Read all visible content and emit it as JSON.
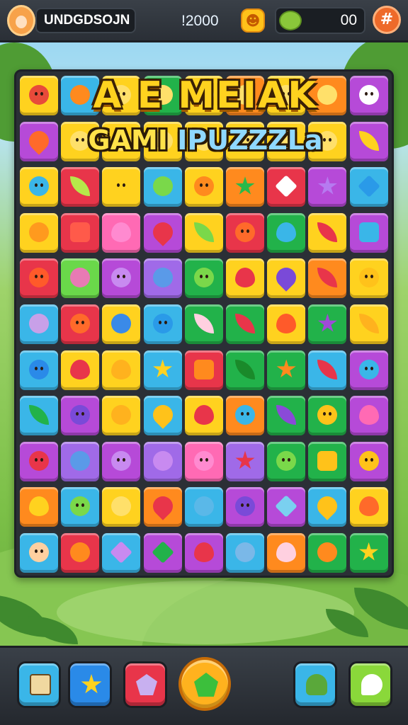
{
  "header": {
    "player_name": "UNDGDSOJN",
    "score": "!2000",
    "gem_count": "00",
    "icons": [
      "avatar",
      "coin-icon",
      "gem-icon",
      "menu-icon"
    ]
  },
  "title": {
    "line1": "A E MEIAK",
    "line2_part1": "GAMI ",
    "line2_part2": "IPUZZZLa"
  },
  "board": {
    "rows": 12,
    "cols": 9,
    "tiles": [
      [
        "#ffd21f:circle:#e84a3a",
        "#3ab6e8:circle:#ff8a1e",
        "#ffd21f:circle:#ffe06a",
        "#22b24a:circle:#ffe06a",
        "#ffd21f:circle:#ffe06a",
        "#ff8a1e:circle:#ffe06a",
        "#ffd21f:circle:#ffe06a",
        "#ff8a1e:circle:#ffe06a",
        "#b64ad8:circle:#ffffff"
      ],
      [
        "#b64ad8:drop:#ff6a2a",
        "#ffd21f:circle:#ffe06a",
        "#ffd21f:circle:#ffe06a",
        "#ffd21f:circle:#ffe06a",
        "#ffd21f:circle:#ffe06a",
        "#ffd21f:circle:#ffe06a",
        "#ffd21f:circle:#ffe06a",
        "#ffd21f:circle:#ffe06a",
        "#b64ad8:leaf:#ffd21f"
      ],
      [
        "#ffd21f:circle:#3ab6e8",
        "#e8354a:leaf:#b6e84a",
        "#ffd21f:circle:#ffd21f",
        "#3ab6e8:circle:#7ad84a",
        "#ffd21f:circle:#ff8a1e",
        "#ff8a1e:star:#2ab84a",
        "#e8354a:diamond:#ffffff",
        "#b64ad8:star:#b67af0",
        "#3ab6e8:diamond:#2a9ae8"
      ],
      [
        "#ffd21f:circle:#ff9a1e",
        "#e8354a:square:#ff5a4a",
        "#ff6ab4:heart:#ff8ad0",
        "#b64ad8:drop:#e8354a",
        "#ffd21f:leaf:#7ad84a",
        "#e8354a:circle:#ff6a2a",
        "#22b24a:heart:#3ab6e8",
        "#ffd21f:leaf:#e8354a",
        "#b64ad8:square:#3ab6e8"
      ],
      [
        "#e8354a:circle:#ff5a2a",
        "#6ad84a:circle:#e87ab4",
        "#b64ad8:circle:#c88af0",
        "#a06ae8:circle:#5a9ae8",
        "#22b24a:circle:#7ad84a",
        "#ffd21f:heart:#e8354a",
        "#ffd21f:drop:#7a4ad8",
        "#ff8a1e:leaf:#e8354a",
        "#ffd21f:circle:#ffc21a"
      ],
      [
        "#3ab6e8:circle:#c8a0e8",
        "#e8354a:circle:#ff6a2a",
        "#ffd21f:circle:#3a8ae8",
        "#3ab6e8:circle:#2a9ae8",
        "#22b24a:leaf:#ffd0e0",
        "#22b24a:leaf:#e8354a",
        "#ffd21f:heart:#ff5a2a",
        "#22b24a:star:#a04ad8",
        "#ffd21f:leaf:#ffb21e"
      ],
      [
        "#3ab6e8:circle:#2a8ae8",
        "#ffd21f:heart:#e8354a",
        "#ffd21f:heart:#ffb21e",
        "#3ab6e8:star:#ffd21f",
        "#e8354a:square:#ff8a1e",
        "#22b24a:leaf:#1a8a2a",
        "#22b24a:star:#ff8a1e",
        "#3ab6e8:leaf:#e8354a",
        "#b64ad8:circle:#3ab6e8"
      ],
      [
        "#3ab6e8:leaf:#22b24a",
        "#b64ad8:circle:#7a4ad8",
        "#ffd21f:circle:#ffb21e",
        "#3ab6e8:drop:#ffc21a",
        "#ffd21f:heart:#e8354a",
        "#ff8a1e:circle:#3ab6e8",
        "#22b24a:leaf:#8a4ad8",
        "#22b24a:circle:#ffc21a",
        "#b64ad8:heart:#ff6ab4"
      ],
      [
        "#b64ad8:circle:#e8354a",
        "#a06ae8:circle:#5a9ae8",
        "#b64ad8:circle:#c88af0",
        "#a06ae8:circle:#c88af0",
        "#ff6ab4:circle:#ff8ad0",
        "#a06ae8:star:#e8354a",
        "#22b24a:circle:#7ad84a",
        "#22b24a:square:#ffc21a",
        "#b64ad8:circle:#ffc21a"
      ],
      [
        "#ff8a1e:heart:#ffd21f",
        "#3ab6e8:circle:#7ad84a",
        "#ffd21f:circle:#ffe06a",
        "#ff8a1e:drop:#e8354a",
        "#3ab6e8:circle:#5ab8e8",
        "#b64ad8:circle:#7a4ad8",
        "#b64ad8:diamond:#7ad0f0",
        "#3ab6e8:drop:#ffc21a",
        "#ffd21f:heart:#ff6a2a"
      ],
      [
        "#3ab6e8:circle:#ffd0a0",
        "#e8354a:circle:#ff8a1e",
        "#3ab6e8:diamond:#c88af0",
        "#b64ad8:diamond:#22b24a",
        "#b64ad8:heart:#e8354a",
        "#3ab6e8:circle:#7ab8e8",
        "#ff8a1e:heart:#ffd0e0",
        "#22b24a:circle:#ff8a1e",
        "#22b24a:star:#ffd21f"
      ]
    ]
  },
  "toolbar": {
    "buttons": [
      {
        "name": "map-button",
        "color": "#3ab6e8",
        "icon": "map-icon"
      },
      {
        "name": "star-button",
        "color": "#2a8ae8",
        "icon": "star-icon"
      },
      {
        "name": "gem-button",
        "color": "#e8354a",
        "icon": "gem-icon"
      },
      {
        "name": "play-button",
        "color": "#ffb21e",
        "icon": "pentagon-icon"
      },
      {
        "name": "helmet-button",
        "color": "#3ab6e8",
        "icon": "helmet-icon"
      },
      {
        "name": "hint-button",
        "color": "#8ad83a",
        "icon": "speech-icon"
      }
    ]
  }
}
